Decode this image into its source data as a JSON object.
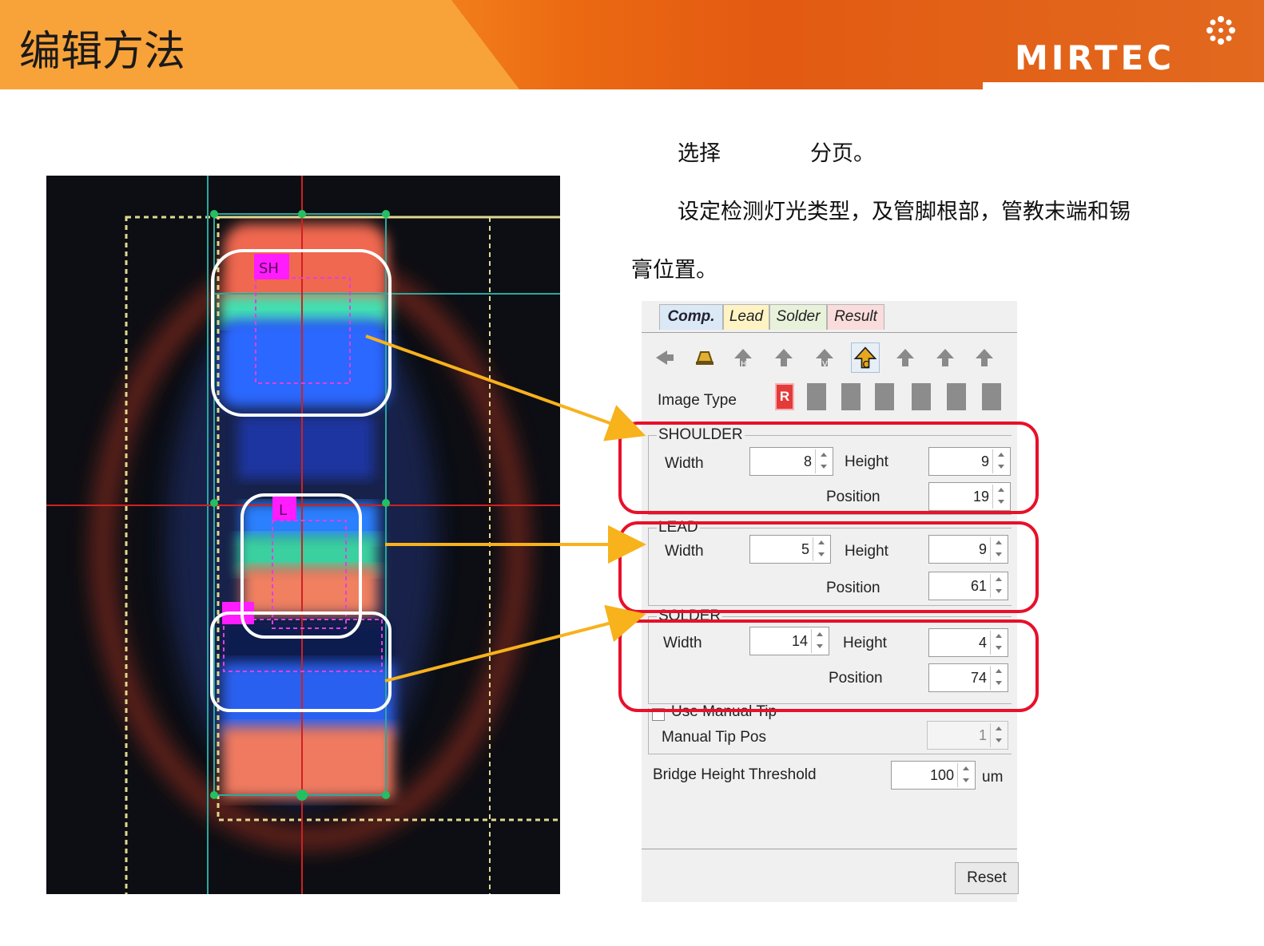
{
  "header": {
    "title": "编辑方法",
    "brand": "MIRTEC"
  },
  "instructions": {
    "line1_prefix": "选择",
    "line1_suffix": "分页。",
    "line2": "设定检测灯光类型，及管脚根部，管教末端和锡",
    "line3": "膏位置。"
  },
  "xray_image": {
    "markers": {
      "shoulder": "SH",
      "lead": "L"
    }
  },
  "panel": {
    "tabs": [
      {
        "label": "Comp.",
        "color": "#dbe8f6",
        "active": true
      },
      {
        "label": "Lead",
        "color": "#fff3c4"
      },
      {
        "label": "Solder",
        "color": "#e8f2da"
      },
      {
        "label": "Result",
        "color": "#fadcdc"
      }
    ],
    "toolbar_icons": [
      "back-arrow-icon",
      "bell-lamp-icon",
      "arrow-h-icon",
      "arrow-up-icon",
      "arrow-v-icon",
      "arrow-c-icon",
      "arrow-up-icon",
      "arrow-up-icon",
      "arrow-up-icon"
    ],
    "image_type": {
      "label": "Image Type",
      "selected": "R",
      "buttons": 7
    },
    "shoulder": {
      "title": "SHOULDER",
      "width_label": "Width",
      "width": "8",
      "height_label": "Height",
      "height": "9",
      "position_label": "Position",
      "position": "19"
    },
    "lead": {
      "title": "LEAD",
      "width_label": "Width",
      "width": "5",
      "height_label": "Height",
      "height": "9",
      "position_label": "Position",
      "position": "61"
    },
    "solder": {
      "title": "SOLDER",
      "width_label": "Width",
      "width": "14",
      "height_label": "Height",
      "height": "4",
      "position_label": "Position",
      "position": "74"
    },
    "manual_tip": {
      "checkbox_label": "Use Manual Tip",
      "checked": false,
      "pos_label": "Manual Tip Pos",
      "pos_value": "1"
    },
    "bridge": {
      "label": "Bridge Height Threshold",
      "value": "100",
      "unit": "um"
    },
    "reset_label": "Reset"
  },
  "colors": {
    "highlight": "#e8102a",
    "arrow": "#f7b21c",
    "banner": "#ec6a12"
  }
}
